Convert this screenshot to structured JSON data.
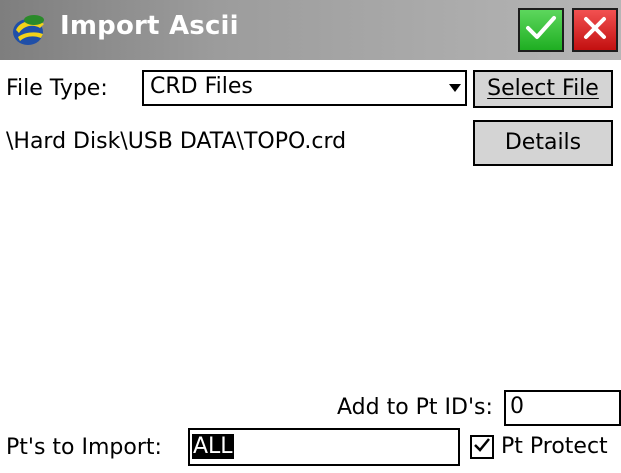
{
  "window": {
    "title": "Import Ascii",
    "ok_icon": "checkmark-icon",
    "cancel_icon": "close-icon",
    "colors": {
      "ok": "#22b022",
      "cancel": "#d01818"
    }
  },
  "file_type": {
    "label": "File Type:",
    "selected": "CRD Files"
  },
  "buttons": {
    "select_file": "Select File",
    "details": "Details"
  },
  "file_path": "\\Hard Disk\\USB DATA\\TOPO.crd",
  "add_to_pt_ids": {
    "label": "Add to Pt ID's:",
    "value": "0"
  },
  "pts_to_import": {
    "label": "Pt's to Import:",
    "value": "ALL"
  },
  "pt_protect": {
    "label": "Pt Protect",
    "checked": true
  }
}
